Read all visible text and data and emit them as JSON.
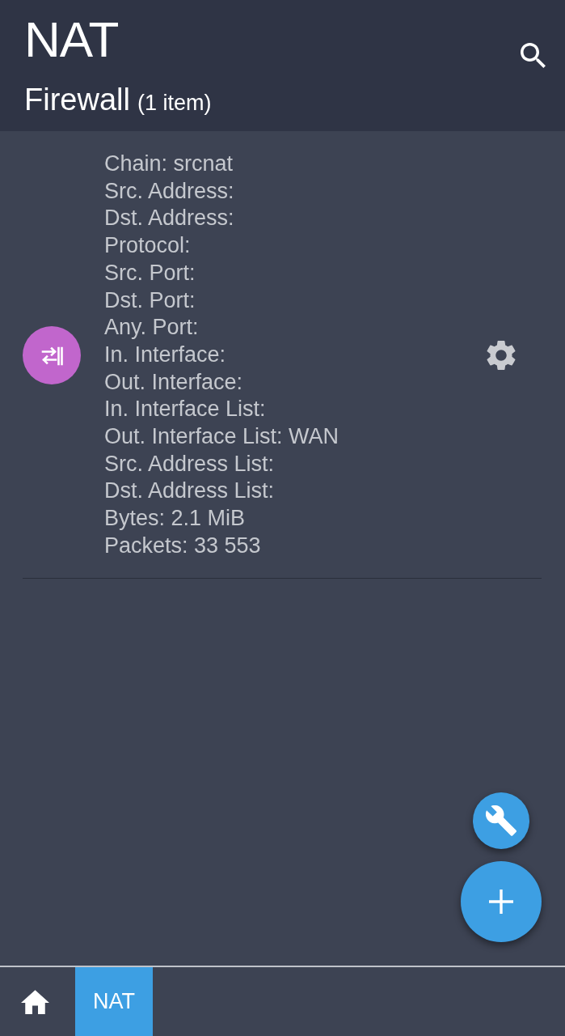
{
  "header": {
    "title": "NAT",
    "subtitle": "Firewall",
    "count": "(1 item)"
  },
  "rules": [
    {
      "fields": [
        "Chain: srcnat",
        "Src. Address:",
        "Dst. Address:",
        "Protocol:",
        "Src. Port:",
        "Dst. Port:",
        "Any. Port:",
        "In. Interface:",
        "Out. Interface:",
        "In. Interface List:",
        "Out. Interface List: WAN",
        "Src. Address List:",
        "Dst. Address List:",
        "Bytes: 2.1 MiB",
        "Packets: 33 553"
      ]
    }
  ],
  "breadcrumbs": [
    {
      "kind": "home",
      "selected": false
    },
    {
      "kind": "page",
      "label": "NAT",
      "selected": true
    }
  ]
}
